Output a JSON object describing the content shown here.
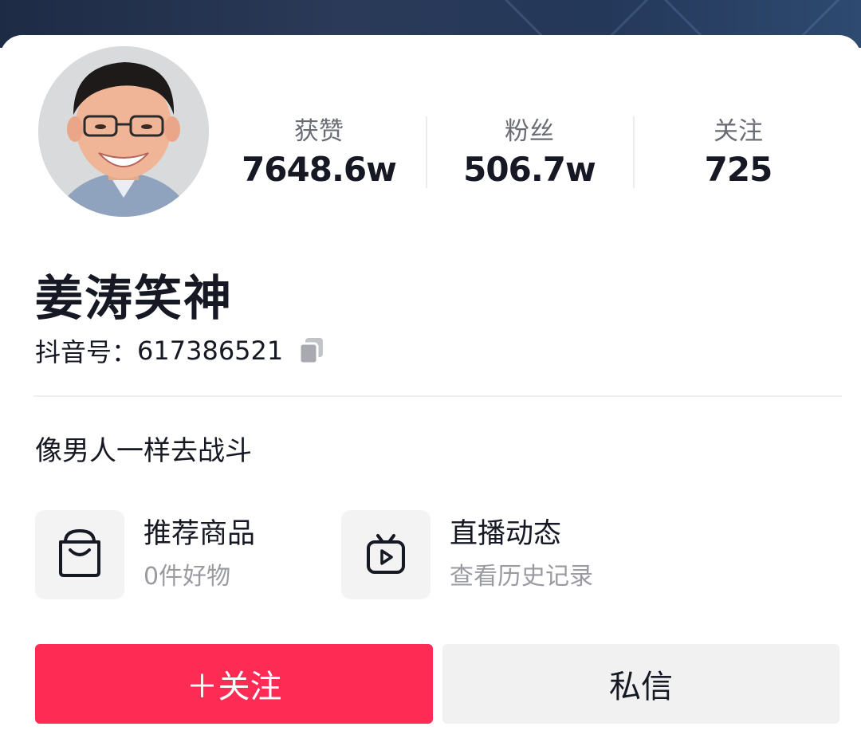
{
  "stats": [
    {
      "label": "获赞",
      "value": "7648.6w"
    },
    {
      "label": "粉丝",
      "value": "506.7w"
    },
    {
      "label": "关注",
      "value": "725"
    }
  ],
  "profile": {
    "name": "姜涛笑神",
    "douyin_id_label": "抖音号：",
    "douyin_id": "617386521",
    "bio": "像男人一样去战斗"
  },
  "entries": [
    {
      "title": "推荐商品",
      "subtitle": "0件好物",
      "icon": "shopping-bag-icon"
    },
    {
      "title": "直播动态",
      "subtitle": "查看历史记录",
      "icon": "tv-play-icon"
    }
  ],
  "actions": {
    "follow_label": "＋关注",
    "message_label": "私信"
  },
  "colors": {
    "accent": "#fe2c55",
    "banner": "#24385a",
    "text_primary": "#161823",
    "text_secondary": "#9a9ba1",
    "button_gray": "#f1f1f2"
  }
}
